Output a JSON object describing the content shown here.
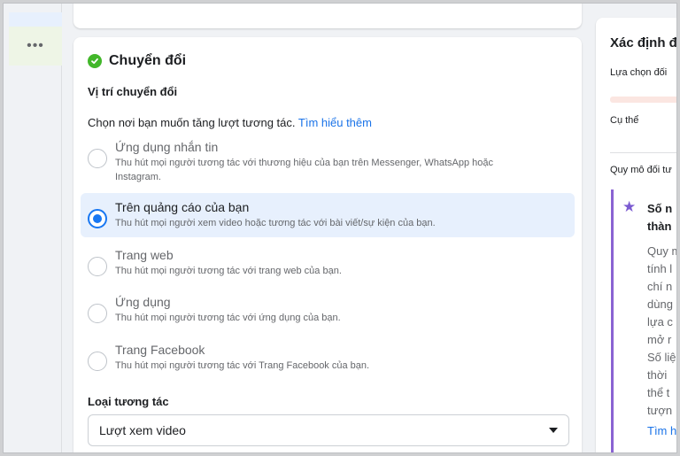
{
  "nav": {
    "more_label": "•••"
  },
  "conversion": {
    "title": "Chuyển đổi",
    "location_heading": "Vị trí chuyển đổi",
    "instruction": "Chọn nơi bạn muốn tăng lượt tương tác.",
    "learn_more": "Tìm hiểu thêm",
    "options": [
      {
        "title": "Ứng dụng nhắn tin",
        "desc": "Thu hút mọi người tương tác với thương hiệu của bạn trên Messenger, WhatsApp hoặc Instagram.",
        "selected": false
      },
      {
        "title": "Trên quảng cáo của bạn",
        "desc": "Thu hút mọi người xem video hoặc tương tác với bài viết/sự kiện của bạn.",
        "selected": true
      },
      {
        "title": "Trang web",
        "desc": "Thu hút mọi người tương tác với trang web của bạn.",
        "selected": false
      },
      {
        "title": "Ứng dụng",
        "desc": "Thu hút mọi người tương tác với ứng dụng của bạn.",
        "selected": false
      },
      {
        "title": "Trang Facebook",
        "desc": "Thu hút mọi người tương tác với Trang Facebook của bạn.",
        "selected": false
      }
    ],
    "engagement_type_label": "Loại tương tác",
    "engagement_type_value": "Lượt xem video"
  },
  "right_panel": {
    "title": "Xác định đ",
    "selection_label": "Lựa chọn đối",
    "specific_label": "Cụ thể",
    "scale_label": "Quy mô đối tư",
    "box_title_line1": "Số n",
    "box_title_line2": "thàn",
    "box_body": [
      "Quy m",
      "tính l",
      "chí n",
      "dùng",
      "lựa c",
      "mở r",
      "Số liệ",
      "thời",
      "thể t",
      "tượn"
    ],
    "box_link": "Tìm h"
  },
  "colors": {
    "accent": "#1877f2",
    "selected_bg": "#e7f0fd",
    "success": "#42b72a",
    "purple": "#8a63d2"
  }
}
